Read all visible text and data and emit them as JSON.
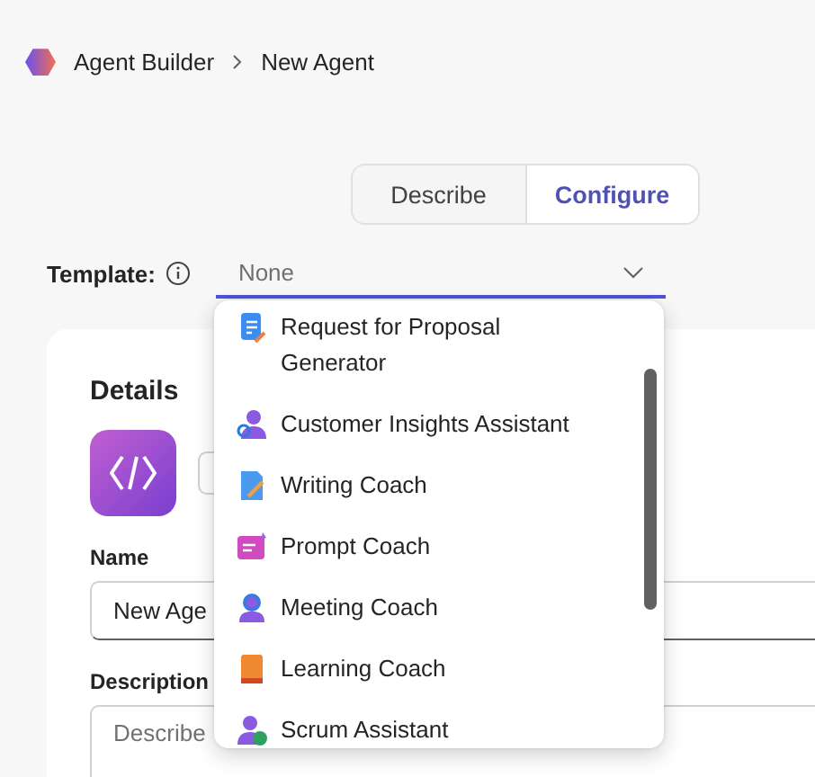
{
  "breadcrumb": [
    "Agent Builder",
    "New Agent"
  ],
  "tabs": [
    {
      "label": "Describe",
      "selected": false
    },
    {
      "label": "Configure",
      "selected": true
    }
  ],
  "template": {
    "label": "Template:",
    "value": "None",
    "expanded": true,
    "options": [
      "Request for Proposal Generator",
      "Customer Insights Assistant",
      "Writing Coach",
      "Prompt Coach",
      "Meeting Coach",
      "Learning Coach",
      "Scrum Assistant"
    ]
  },
  "details": {
    "title": "Details",
    "name_label": "Name",
    "name_value": "New Age",
    "description_label": "Description",
    "description_placeholder": "Describe"
  }
}
